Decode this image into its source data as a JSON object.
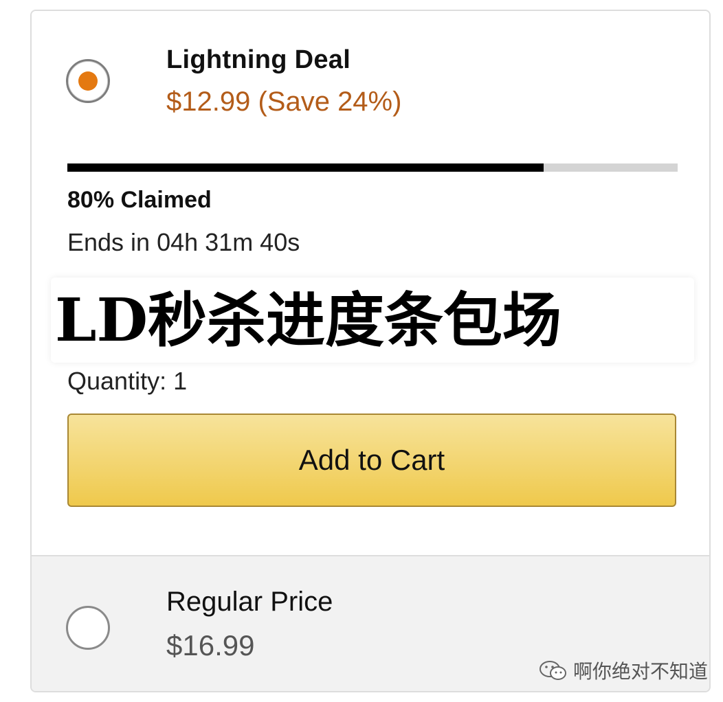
{
  "deal_option": {
    "title": "Lightning Deal",
    "price": "$12.99 (Save 24%)",
    "selected": true,
    "claimed_fraction": 0.78,
    "claimed_text": "80% Claimed",
    "ends_text": "Ends in 04h 31m 40s"
  },
  "overlay": {
    "text": "LD秒杀进度条包场"
  },
  "quantity_text": "Quantity: 1",
  "add_to_cart_label": "Add to Cart",
  "regular_option": {
    "title": "Regular Price",
    "price": "$16.99",
    "selected": false
  },
  "watermark": {
    "text": "啊你绝对不知道",
    "icon": "wechat-icon"
  },
  "colors": {
    "accent_orange": "#e47911",
    "price_orange": "#b35c19",
    "button_yellow": "#efc94c",
    "progress_fill": "#000000",
    "progress_track": "#d4d4d4"
  }
}
